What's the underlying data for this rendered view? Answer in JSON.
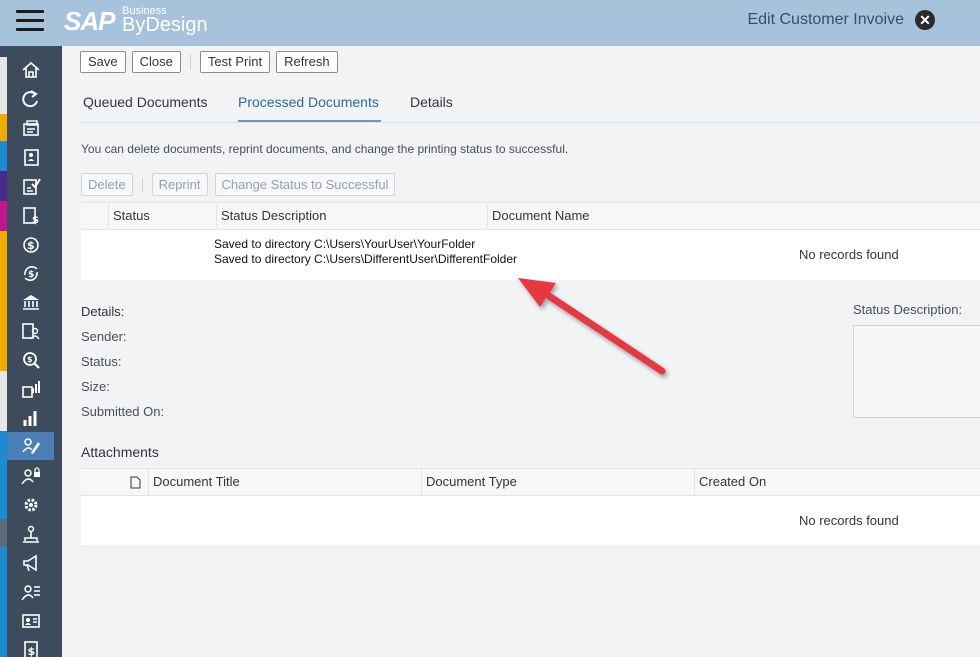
{
  "header": {
    "logo_sap": "SAP",
    "logo_business": "Business",
    "logo_bydesign": "ByDesign",
    "title": "Edit Customer Invoive"
  },
  "toolbar": {
    "save": "Save",
    "close": "Close",
    "test_print": "Test Print",
    "refresh": "Refresh"
  },
  "tabs": [
    "Queued Documents",
    "Processed Documents",
    "Details"
  ],
  "info_text": "You can delete documents, reprint documents, and change the printing status to successful.",
  "actions": {
    "delete": "Delete",
    "reprint": "Reprint",
    "change_status": "Change Status to Successful"
  },
  "processed_table": {
    "columns": [
      "Status",
      "Status Description",
      "Document Name"
    ],
    "empty_text": "No records found",
    "overlay_lines": [
      "Saved to directory C:\\Users\\YourUser\\YourFolder",
      "Saved to directory C:\\Users\\DifferentUser\\DifferentFolder"
    ]
  },
  "details": {
    "title": "Details:",
    "fields": [
      "Sender:",
      "Status:",
      "Size:",
      "Submitted On:"
    ],
    "status_description_label": "Status Description:"
  },
  "attachments": {
    "title": "Attachments",
    "columns": [
      "Document Title",
      "Document Type",
      "Created On"
    ],
    "empty_text": "No records found"
  },
  "colors": {
    "header_bg": "#a7c3dc",
    "sidebar_bg": "#3d4b5c",
    "active_tab": "#2f6aa0",
    "arrow": "#e5393f"
  },
  "sidebar_icons": [
    "home-icon",
    "refresh-icon",
    "documents-icon",
    "customer-invoice-icon",
    "approval-list-icon",
    "payment-doc-icon",
    "money-icon",
    "money-cycle-icon",
    "bank-icon",
    "customer-account-icon",
    "search-money-icon",
    "report-chart-icon",
    "bar-chart-icon",
    "edit-user-icon",
    "user-lock-icon",
    "gear-settings-icon",
    "org-chart-icon",
    "megaphone-icon",
    "user-list-icon",
    "id-card-icon",
    "invoice-icon"
  ]
}
